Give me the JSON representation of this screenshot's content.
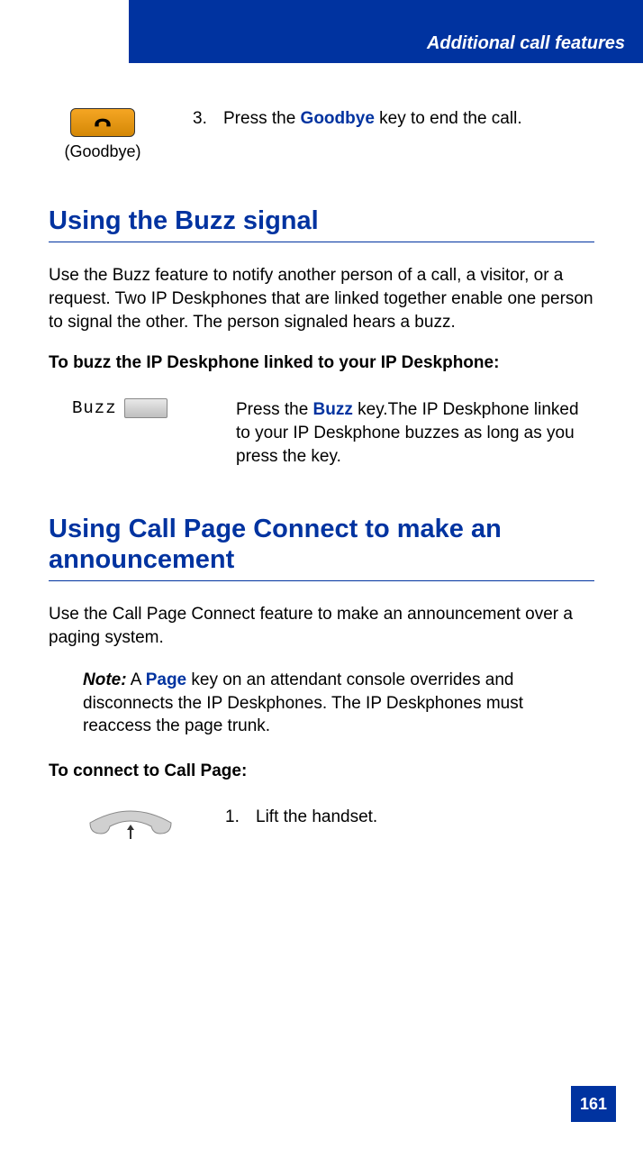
{
  "header": {
    "title": "Additional call features"
  },
  "step3": {
    "icon_label": "(Goodbye)",
    "num": "3.",
    "text_prefix": "Press the ",
    "text_key": "Goodbye",
    "text_suffix": " key to end the call."
  },
  "section1": {
    "heading": "Using the Buzz signal",
    "body": "Use the Buzz feature to notify another person of a call, a visitor, or a request. Two IP Deskphones that are linked together enable one person to signal the other. The person signaled hears a buzz.",
    "subheading": "To buzz the IP Deskphone linked to your IP Deskphone:",
    "buzz_label": "Buzz",
    "buzz_text_prefix": "Press the ",
    "buzz_text_key": "Buzz",
    "buzz_text_suffix": " key.The IP Deskphone linked to your IP Deskphone buzzes as long as you press the key."
  },
  "section2": {
    "heading": "Using Call Page Connect to make an announcement",
    "body": "Use the Call Page Connect feature to make an announcement over a paging system.",
    "note_label": "Note:",
    "note_prefix": " A ",
    "note_key": "Page",
    "note_suffix": " key on an attendant console overrides and disconnects the IP Deskphones. The IP Deskphones must reaccess the page trunk.",
    "subheading": "To connect to Call Page:",
    "step1_num": "1.",
    "step1_text": "Lift the handset."
  },
  "page_number": "161"
}
